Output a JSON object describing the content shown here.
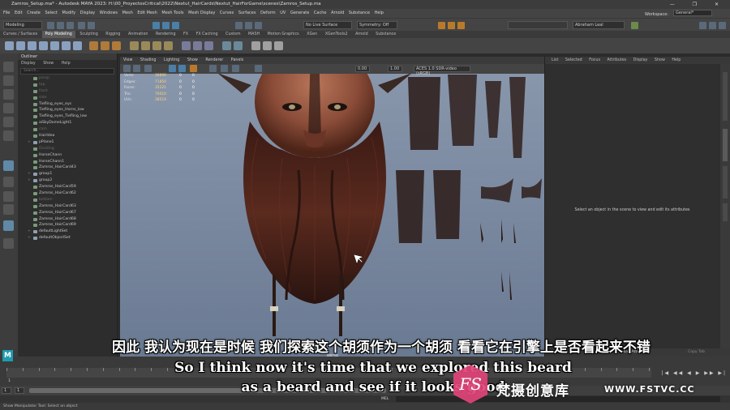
{
  "titlebar": {
    "title": "Zamros_Setup.ma* - Autodesk MAYA 2023: H:\\00_ProyectosCritical\\2022\\Nextut_HairCards\\Nextut_HairForGame\\scenes\\Zamros_Setup.ma",
    "controls": "—  ❐  ✕"
  },
  "menubar": {
    "items": [
      "File",
      "Edit",
      "Create",
      "Select",
      "Modify",
      "Display",
      "Windows",
      "Mesh",
      "Edit Mesh",
      "Mesh Tools",
      "Mesh Display",
      "Curves",
      "Surfaces",
      "Deform",
      "UV",
      "Generate",
      "Cache",
      "Arnold",
      "Substance",
      "Help"
    ],
    "workspace_label": "Workspace:",
    "workspace_value": "General*"
  },
  "statusline": {
    "mode": "Modeling",
    "no_live_surface": "No Live Surface",
    "symmetry": "Symmetry: Off",
    "user": "Abraham Leal"
  },
  "shelf_tabs": [
    "Curves / Surfaces",
    "Poly Modeling",
    "Sculpting",
    "Rigging",
    "Animation",
    "Rendering",
    "FX",
    "FX Caching",
    "Custom",
    "MASH",
    "Motion Graphics",
    "XGen",
    "XGenTools2",
    "Arnold",
    "Substance"
  ],
  "active_shelf_tab": "Poly Modeling",
  "outliner": {
    "title": "Outliner",
    "menu": [
      "Display",
      "Show",
      "Help"
    ],
    "search_placeholder": "Search...",
    "items": [
      {
        "label": "persp",
        "dim": true
      },
      {
        "label": "top",
        "dim": true
      },
      {
        "label": "front",
        "dim": true
      },
      {
        "label": "side",
        "dim": true
      },
      {
        "label": "Tiefling_eyes_eys",
        "dim": false
      },
      {
        "label": "Tiefling_eyes_Horns_low",
        "dim": false
      },
      {
        "label": "Tiefling_eyes_Tiefling_low",
        "dim": false
      },
      {
        "label": "aiSkyDomeLight1",
        "dim": false
      },
      {
        "label": "cam",
        "dim": true
      },
      {
        "label": "HairIdea",
        "dim": false
      },
      {
        "label": "pPlane1",
        "dim": false
      },
      {
        "label": "Dividing",
        "dim": true
      },
      {
        "label": "HorseChann",
        "dim": false
      },
      {
        "label": "HorseChann1",
        "dim": false
      },
      {
        "label": "Zamros_HairCard43",
        "dim": false
      },
      {
        "label": "group1",
        "dim": false
      },
      {
        "label": "group2",
        "dim": false
      },
      {
        "label": "Zamros_HairCard59",
        "dim": false
      },
      {
        "label": "Zamros_HairCard62",
        "dim": false
      },
      {
        "label": "bottom",
        "dim": true
      },
      {
        "label": "Zamros_HairCard63",
        "dim": false
      },
      {
        "label": "Zamros_HairCard67",
        "dim": false
      },
      {
        "label": "Zamros_HairCard68",
        "dim": false
      },
      {
        "label": "Zamros_HairCard69",
        "dim": false
      },
      {
        "label": "defaultLightSet",
        "dim": false
      },
      {
        "label": "defaultObjectSet",
        "dim": false
      }
    ]
  },
  "viewport": {
    "menu": [
      "View",
      "Shading",
      "Lighting",
      "Show",
      "Renderer",
      "Panels"
    ],
    "colorspace": "ACES 1.0 SDR-video (sRGB)",
    "exposure": "0.00",
    "gamma": "1.00",
    "camera_label": "persp",
    "hud": [
      {
        "key": "Verts:",
        "value": "36890",
        "a": "0",
        "b": "0"
      },
      {
        "key": "Edges:",
        "value": "71850",
        "a": "0",
        "b": "0"
      },
      {
        "key": "Faces:",
        "value": "35221",
        "a": "0",
        "b": "0"
      },
      {
        "key": "Tris:",
        "value": "70010",
        "a": "0",
        "b": "0"
      },
      {
        "key": "UVs:",
        "value": "38519",
        "a": "0",
        "b": "0"
      }
    ]
  },
  "attribute_editor": {
    "menu": [
      "List",
      "Selected",
      "Focus",
      "Attributes",
      "Display",
      "Show",
      "Help"
    ],
    "empty_message": "Select an object in the scene to view and edit its attributes",
    "load_button": "Load Attributes",
    "copy_tab_button": "Copy Tab",
    "side_tabs": [
      "Channel Box / Layer Editor",
      "Attribute Editor",
      "Modeling Toolkit",
      "Tool Settings"
    ]
  },
  "timeline": {
    "start": "1",
    "current": "1"
  },
  "cmdline": {
    "lang": "MEL"
  },
  "helpline": {
    "text": "Show Manipulator Tool: Select an object"
  },
  "subtitles": {
    "zh": "因此 我认为现在是时候 我们探索这个胡须作为一个胡须 看看它在引擎上是否看起来不错",
    "en1": "So I think now it's time that we explored this beard",
    "en2": "as a beard and see if it looks good"
  },
  "watermark": {
    "logo_letters": "FS",
    "name": "梵摄创意库",
    "url": "WWW.FSTVC.CC"
  },
  "colors": {
    "viewport_bg": "#8695ab",
    "hud_value": "#ffd27a",
    "logo_pink": "#e0447a",
    "maya_badge": "#1f9ab0"
  }
}
